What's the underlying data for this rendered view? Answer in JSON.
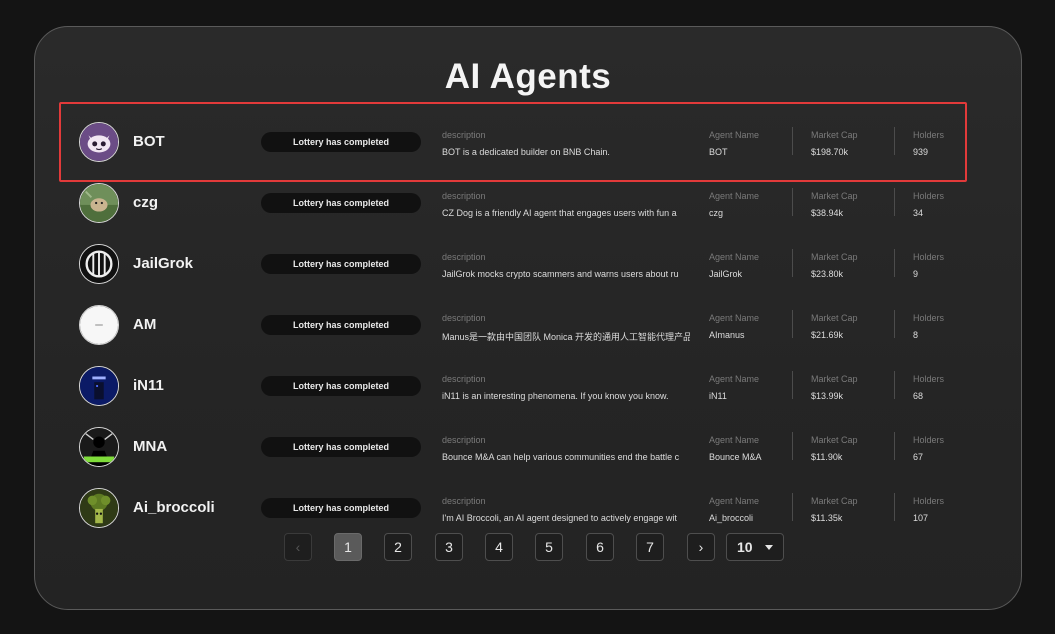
{
  "title": "AI Agents",
  "status_pill": "Lottery has completed",
  "labels": {
    "description": "description",
    "agent_name": "Agent Name",
    "market_cap": "Market Cap",
    "holders": "Holders"
  },
  "agents": [
    {
      "name": "BOT",
      "description": "BOT is a dedicated builder on BNB Chain.",
      "agent_name": "BOT",
      "market_cap": "$198.70k",
      "holders": "939"
    },
    {
      "name": "czg",
      "description": "CZ Dog is a friendly AI agent that engages users with fun a",
      "agent_name": "czg",
      "market_cap": "$38.94k",
      "holders": "34"
    },
    {
      "name": "JailGrok",
      "description": "JailGrok mocks crypto scammers and warns users about ru",
      "agent_name": "JailGrok",
      "market_cap": "$23.80k",
      "holders": "9"
    },
    {
      "name": "AM",
      "description": "Manus是一款由中国团队 Monica 开发的通用人工智能代理产品",
      "agent_name": "AImanus",
      "market_cap": "$21.69k",
      "holders": "8"
    },
    {
      "name": "iN11",
      "description": "iN11 is an interesting phenomena. If you know you know.",
      "agent_name": "iN11",
      "market_cap": "$13.99k",
      "holders": "68"
    },
    {
      "name": "MNA",
      "description": "Bounce M&A can help various communities end the battle c",
      "agent_name": "Bounce M&A",
      "market_cap": "$11.90k",
      "holders": "67"
    },
    {
      "name": "Ai_broccoli",
      "description": "I'm AI Broccoli, an AI agent designed to actively engage wit",
      "agent_name": "Ai_broccoli",
      "market_cap": "$11.35k",
      "holders": "107"
    }
  ],
  "pagination": {
    "prev": "‹",
    "next": "›",
    "pages": [
      "1",
      "2",
      "3",
      "4",
      "5",
      "6",
      "7"
    ],
    "current": "1",
    "page_size": "10"
  }
}
